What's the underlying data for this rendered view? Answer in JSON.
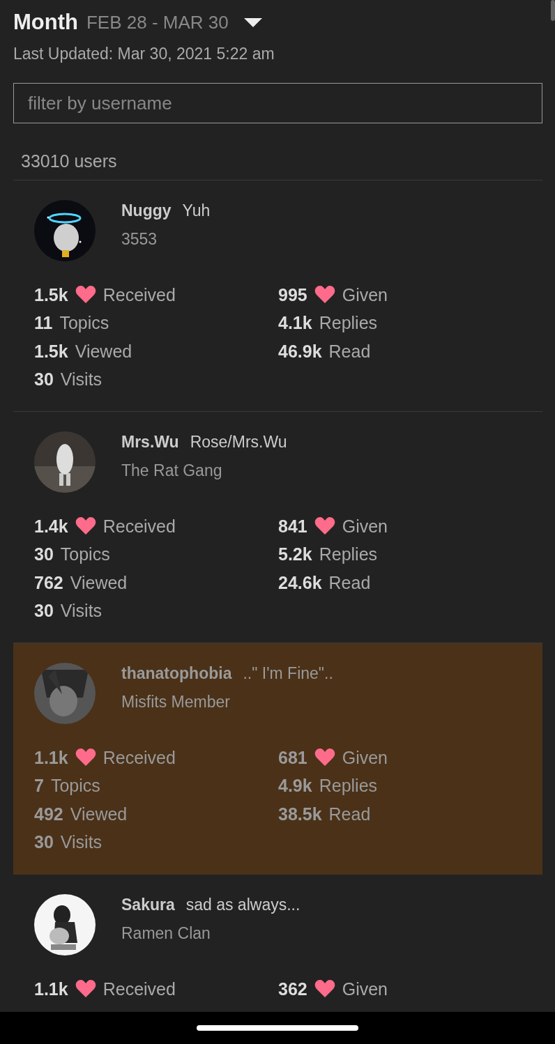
{
  "header": {
    "period": "Month",
    "range": "FEB 28 - MAR 30",
    "last_updated": "Last Updated: Mar 30, 2021 5:22 am"
  },
  "search": {
    "placeholder": "filter by username"
  },
  "user_count": "33010 users",
  "users": [
    {
      "name": "Nuggy",
      "title": "Yuh",
      "subtitle": "3553",
      "highlighted": false,
      "left": [
        {
          "amount": "1.5k",
          "metric": "Received",
          "heart": true
        },
        {
          "amount": "11",
          "metric": "Topics",
          "heart": false
        },
        {
          "amount": "1.5k",
          "metric": "Viewed",
          "heart": false
        },
        {
          "amount": "30",
          "metric": "Visits",
          "heart": false
        }
      ],
      "right": [
        {
          "amount": "995",
          "metric": "Given",
          "heart": true
        },
        {
          "amount": "4.1k",
          "metric": "Replies",
          "heart": false
        },
        {
          "amount": "46.9k",
          "metric": "Read",
          "heart": false
        }
      ]
    },
    {
      "name": "Mrs.Wu",
      "title": "Rose/Mrs.Wu",
      "subtitle": "The Rat Gang",
      "highlighted": false,
      "left": [
        {
          "amount": "1.4k",
          "metric": "Received",
          "heart": true
        },
        {
          "amount": "30",
          "metric": "Topics",
          "heart": false
        },
        {
          "amount": "762",
          "metric": "Viewed",
          "heart": false
        },
        {
          "amount": "30",
          "metric": "Visits",
          "heart": false
        }
      ],
      "right": [
        {
          "amount": "841",
          "metric": "Given",
          "heart": true
        },
        {
          "amount": "5.2k",
          "metric": "Replies",
          "heart": false
        },
        {
          "amount": "24.6k",
          "metric": "Read",
          "heart": false
        }
      ]
    },
    {
      "name": "thanatophobia",
      "title": "..\" I'm Fine\"..",
      "subtitle": "Misfits Member",
      "highlighted": true,
      "left": [
        {
          "amount": "1.1k",
          "metric": "Received",
          "heart": true
        },
        {
          "amount": "7",
          "metric": "Topics",
          "heart": false
        },
        {
          "amount": "492",
          "metric": "Viewed",
          "heart": false
        },
        {
          "amount": "30",
          "metric": "Visits",
          "heart": false
        }
      ],
      "right": [
        {
          "amount": "681",
          "metric": "Given",
          "heart": true
        },
        {
          "amount": "4.9k",
          "metric": "Replies",
          "heart": false
        },
        {
          "amount": "38.5k",
          "metric": "Read",
          "heart": false
        }
      ]
    },
    {
      "name": "Sakura",
      "title": "sad as always...",
      "subtitle": "Ramen Clan",
      "highlighted": false,
      "left": [
        {
          "amount": "1.1k",
          "metric": "Received",
          "heart": true
        }
      ],
      "right": [
        {
          "amount": "362",
          "metric": "Given",
          "heart": true
        }
      ]
    }
  ]
}
